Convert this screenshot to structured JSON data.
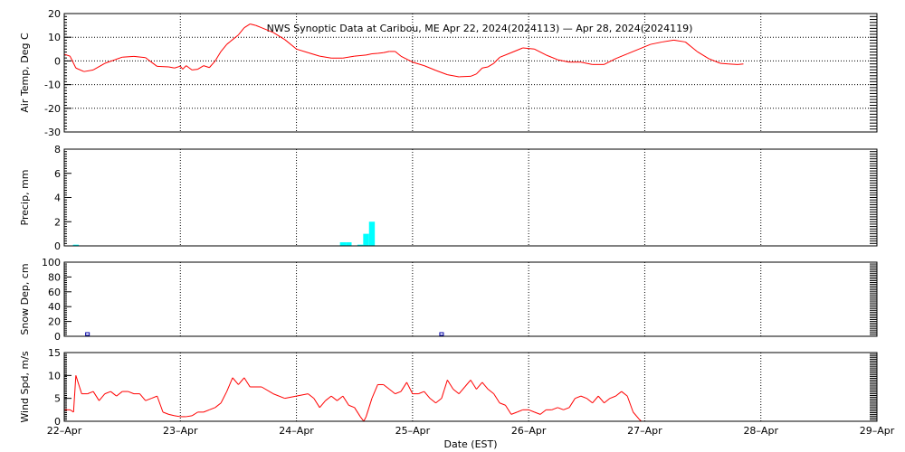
{
  "chart_data": {
    "type": "multi-panel time series",
    "title": "NWS Synoptic Data at Caribou, ME   Apr 22, 2024(2024113) — Apr 28, 2024(2024119)",
    "xlabel": "Date (EST)",
    "x_tick_labels": [
      "22–Apr",
      "23–Apr",
      "24–Apr",
      "25–Apr",
      "26–Apr",
      "27–Apr",
      "28–Apr",
      "29–Apr"
    ],
    "x_range_days": [
      0,
      7
    ],
    "colors": {
      "temp": "#ff0000",
      "precip": "#00ffff",
      "snow": "#0000aa",
      "wind": "#ff0000"
    },
    "panels": [
      {
        "key": "temp",
        "type": "line",
        "ylabel": "Air Temp, Deg C",
        "ylim": [
          -30,
          20
        ],
        "yticks": [
          20,
          10,
          0,
          -10,
          -20,
          -30
        ],
        "points": [
          [
            0,
            2.8
          ],
          [
            0.05,
            2.0
          ],
          [
            0.1,
            -3.0
          ],
          [
            0.17,
            -4.5
          ],
          [
            0.25,
            -3.8
          ],
          [
            0.35,
            -1.0
          ],
          [
            0.5,
            1.6
          ],
          [
            0.6,
            1.9
          ],
          [
            0.7,
            1.4
          ],
          [
            0.75,
            -0.5
          ],
          [
            0.8,
            -2.3
          ],
          [
            0.9,
            -2.5
          ],
          [
            0.95,
            -3.0
          ],
          [
            1.0,
            -2.2
          ],
          [
            1.02,
            -3.5
          ],
          [
            1.05,
            -2.0
          ],
          [
            1.1,
            -3.8
          ],
          [
            1.15,
            -3.5
          ],
          [
            1.2,
            -2.0
          ],
          [
            1.25,
            -2.8
          ],
          [
            1.3,
            0.0
          ],
          [
            1.35,
            4.0
          ],
          [
            1.4,
            7.0
          ],
          [
            1.45,
            9.0
          ],
          [
            1.5,
            11.0
          ],
          [
            1.55,
            14.0
          ],
          [
            1.6,
            15.6
          ],
          [
            1.65,
            15.0
          ],
          [
            1.7,
            14.0
          ],
          [
            1.8,
            12.0
          ],
          [
            1.9,
            9.0
          ],
          [
            2.0,
            5.0
          ],
          [
            2.1,
            3.5
          ],
          [
            2.2,
            2.0
          ],
          [
            2.3,
            1.2
          ],
          [
            2.4,
            1.2
          ],
          [
            2.5,
            2.0
          ],
          [
            2.6,
            2.5
          ],
          [
            2.65,
            3.0
          ],
          [
            2.7,
            3.2
          ],
          [
            2.75,
            3.5
          ],
          [
            2.8,
            4.0
          ],
          [
            2.85,
            4.0
          ],
          [
            2.9,
            2.0
          ],
          [
            3.0,
            -0.5
          ],
          [
            3.1,
            -2.0
          ],
          [
            3.2,
            -4.0
          ],
          [
            3.3,
            -5.8
          ],
          [
            3.4,
            -6.7
          ],
          [
            3.5,
            -6.5
          ],
          [
            3.55,
            -5.5
          ],
          [
            3.6,
            -3.0
          ],
          [
            3.65,
            -2.5
          ],
          [
            3.7,
            -1.0
          ],
          [
            3.75,
            1.5
          ],
          [
            3.85,
            3.5
          ],
          [
            3.95,
            5.5
          ],
          [
            4.05,
            5.0
          ],
          [
            4.15,
            2.5
          ],
          [
            4.25,
            0.5
          ],
          [
            4.35,
            -0.5
          ],
          [
            4.45,
            -0.5
          ],
          [
            4.55,
            -1.5
          ],
          [
            4.65,
            -1.5
          ],
          [
            4.75,
            1.0
          ],
          [
            4.85,
            3.0
          ],
          [
            4.95,
            5.0
          ],
          [
            5.05,
            7.0
          ],
          [
            5.15,
            8.0
          ],
          [
            5.25,
            8.8
          ],
          [
            5.35,
            8.0
          ],
          [
            5.45,
            4.0
          ],
          [
            5.55,
            1.0
          ],
          [
            5.65,
            -1.0
          ],
          [
            5.72,
            -1.3
          ],
          [
            5.8,
            -1.5
          ],
          [
            5.85,
            -1.3
          ]
        ]
      },
      {
        "key": "precip",
        "type": "bar",
        "ylabel": "Precip, mm",
        "ylim": [
          0,
          8
        ],
        "yticks": [
          8,
          6,
          4,
          2,
          0
        ],
        "bars": [
          [
            0.1,
            0.1
          ],
          [
            2.4,
            0.3
          ],
          [
            2.45,
            0.3
          ],
          [
            2.55,
            0.1
          ],
          [
            2.6,
            1.0
          ],
          [
            2.65,
            2.0
          ]
        ],
        "bar_width_days": 0.05
      },
      {
        "key": "snow",
        "type": "marker",
        "ylabel": "Snow Dep, cm",
        "ylim": [
          0,
          100
        ],
        "yticks": [
          100,
          80,
          60,
          40,
          20,
          0
        ],
        "markers": [
          [
            0.2,
            0
          ],
          [
            3.25,
            0
          ]
        ]
      },
      {
        "key": "wind",
        "type": "line",
        "ylabel": "Wind Spd, m/s",
        "ylim": [
          0,
          15
        ],
        "yticks": [
          15,
          10,
          5,
          0
        ],
        "points": [
          [
            0,
            2.5
          ],
          [
            0.05,
            2.5
          ],
          [
            0.08,
            2.0
          ],
          [
            0.1,
            10.0
          ],
          [
            0.15,
            6.0
          ],
          [
            0.2,
            6.0
          ],
          [
            0.25,
            6.5
          ],
          [
            0.3,
            4.5
          ],
          [
            0.35,
            6.0
          ],
          [
            0.4,
            6.5
          ],
          [
            0.45,
            5.5
          ],
          [
            0.5,
            6.5
          ],
          [
            0.55,
            6.5
          ],
          [
            0.6,
            6.0
          ],
          [
            0.65,
            6.0
          ],
          [
            0.7,
            4.5
          ],
          [
            0.75,
            5.0
          ],
          [
            0.8,
            5.5
          ],
          [
            0.85,
            2.0
          ],
          [
            0.9,
            1.5
          ],
          [
            0.95,
            1.2
          ],
          [
            1.0,
            1.0
          ],
          [
            1.05,
            1.0
          ],
          [
            1.1,
            1.2
          ],
          [
            1.15,
            2.0
          ],
          [
            1.2,
            2.0
          ],
          [
            1.25,
            2.5
          ],
          [
            1.3,
            3.0
          ],
          [
            1.35,
            4.0
          ],
          [
            1.4,
            6.5
          ],
          [
            1.45,
            9.5
          ],
          [
            1.5,
            8.0
          ],
          [
            1.55,
            9.5
          ],
          [
            1.6,
            7.5
          ],
          [
            1.7,
            7.5
          ],
          [
            1.8,
            6.0
          ],
          [
            1.9,
            5.0
          ],
          [
            2.0,
            5.5
          ],
          [
            2.1,
            6.0
          ],
          [
            2.15,
            5.0
          ],
          [
            2.2,
            3.0
          ],
          [
            2.25,
            4.5
          ],
          [
            2.3,
            5.5
          ],
          [
            2.35,
            4.5
          ],
          [
            2.4,
            5.5
          ],
          [
            2.45,
            3.5
          ],
          [
            2.5,
            3.0
          ],
          [
            2.55,
            1.0
          ],
          [
            2.58,
            0.0
          ],
          [
            2.6,
            1.0
          ],
          [
            2.65,
            5.0
          ],
          [
            2.7,
            8.0
          ],
          [
            2.75,
            8.0
          ],
          [
            2.8,
            7.0
          ],
          [
            2.85,
            6.0
          ],
          [
            2.9,
            6.5
          ],
          [
            2.95,
            8.5
          ],
          [
            3.0,
            6.0
          ],
          [
            3.05,
            6.0
          ],
          [
            3.1,
            6.5
          ],
          [
            3.15,
            5.0
          ],
          [
            3.2,
            4.0
          ],
          [
            3.25,
            5.0
          ],
          [
            3.3,
            9.0
          ],
          [
            3.35,
            7.0
          ],
          [
            3.4,
            6.0
          ],
          [
            3.45,
            7.5
          ],
          [
            3.5,
            9.0
          ],
          [
            3.55,
            7.0
          ],
          [
            3.6,
            8.5
          ],
          [
            3.65,
            7.0
          ],
          [
            3.7,
            6.0
          ],
          [
            3.75,
            4.0
          ],
          [
            3.8,
            3.5
          ],
          [
            3.85,
            1.5
          ],
          [
            3.9,
            2.0
          ],
          [
            3.95,
            2.5
          ],
          [
            4.0,
            2.5
          ],
          [
            4.05,
            2.0
          ],
          [
            4.1,
            1.5
          ],
          [
            4.15,
            2.5
          ],
          [
            4.2,
            2.5
          ],
          [
            4.25,
            3.0
          ],
          [
            4.3,
            2.5
          ],
          [
            4.35,
            3.0
          ],
          [
            4.4,
            5.0
          ],
          [
            4.45,
            5.5
          ],
          [
            4.5,
            5.0
          ],
          [
            4.55,
            4.0
          ],
          [
            4.6,
            5.5
          ],
          [
            4.65,
            4.0
          ],
          [
            4.7,
            5.0
          ],
          [
            4.75,
            5.5
          ],
          [
            4.8,
            6.5
          ],
          [
            4.85,
            5.5
          ],
          [
            4.9,
            2.0
          ],
          [
            4.95,
            0.5
          ],
          [
            4.97,
            0.0
          ]
        ]
      }
    ]
  }
}
